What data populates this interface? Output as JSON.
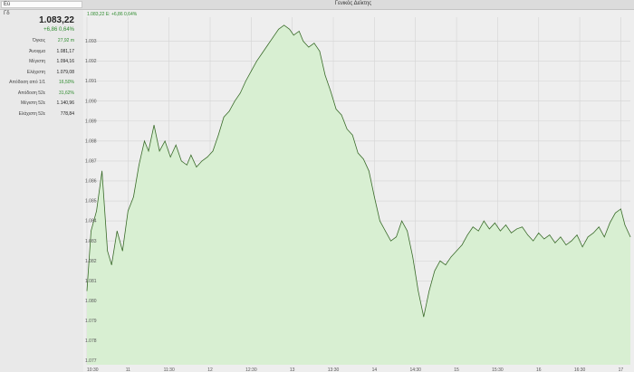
{
  "topbar": {
    "search_value": "Εύ",
    "title": "Γενικός Δείκτης"
  },
  "side": {
    "ticker": "Γδ",
    "last_price": "1.083,22",
    "change": "+6,86  0,64%",
    "stats": [
      {
        "label": "Όγκος",
        "value": "27,92 m",
        "positive": true
      },
      {
        "label": "Άνοιγμα",
        "value": "1.081,17",
        "positive": false
      },
      {
        "label": "Μέγιστη",
        "value": "1.094,16",
        "positive": false
      },
      {
        "label": "Ελάχιστη",
        "value": "1.079,08",
        "positive": false
      },
      {
        "label": "Απόδοση από 1/1",
        "value": "16,50%",
        "positive": true
      },
      {
        "label": "Απόδοση 52ε",
        "value": "31,62%",
        "positive": true
      },
      {
        "label": "Μέγιστη 52ε",
        "value": "1.140,96",
        "positive": false
      },
      {
        "label": "Ελάχιστη 52ε",
        "value": "778,84",
        "positive": false
      }
    ]
  },
  "colors": {
    "line": "#3a6b2a",
    "fill": "#d8efd2",
    "accent": "#2e8b2e"
  },
  "chart_data": {
    "type": "area",
    "header_label": "1.083,22 Ε: +6,86 0,64%",
    "ylim": [
      1076.8,
      1094.2
    ],
    "yticks": [
      1077,
      1078,
      1079,
      1080,
      1081,
      1082,
      1083,
      1084,
      1085,
      1086,
      1087,
      1088,
      1089,
      1090,
      1091,
      1092,
      1093
    ],
    "ytick_labels": [
      "1.077",
      "1.078",
      "1.079",
      "1.080",
      "1.081",
      "1.082",
      "1.083",
      "1.084",
      "1.085",
      "1.086",
      "1.087",
      "1.088",
      "1.089",
      "1.090",
      "1.091",
      "1.092",
      "1.093"
    ],
    "x_start": "10:30",
    "x_end": "17:07",
    "xticks": [
      "10:30",
      "11",
      "11:30",
      "12",
      "12:30",
      "13",
      "13:30",
      "14",
      "14:30",
      "15",
      "15:30",
      "16",
      "16:30",
      "17"
    ],
    "xtick_times": [
      "10:30",
      "11:00",
      "11:30",
      "12:00",
      "12:30",
      "13:00",
      "13:30",
      "14:00",
      "14:30",
      "15:00",
      "15:30",
      "16:00",
      "16:30",
      "17:00"
    ],
    "series": [
      {
        "times": [
          "10:30",
          "10:33",
          "10:37",
          "10:41",
          "10:45",
          "10:48",
          "10:52",
          "10:56",
          "11:00",
          "11:04",
          "11:08",
          "11:12",
          "11:15",
          "11:19",
          "11:23",
          "11:27",
          "11:31",
          "11:35",
          "11:39",
          "11:43",
          "11:46",
          "11:50",
          "11:54",
          "11:58",
          "12:02",
          "12:06",
          "12:10",
          "12:14",
          "12:18",
          "12:22",
          "12:26",
          "12:30",
          "12:34",
          "12:38",
          "12:42",
          "12:46",
          "12:50",
          "12:54",
          "12:58",
          "13:01",
          "13:05",
          "13:08",
          "13:12",
          "13:16",
          "13:20",
          "13:24",
          "13:28",
          "13:32",
          "13:36",
          "13:40",
          "13:44",
          "13:48",
          "13:52",
          "13:56",
          "14:00",
          "14:04",
          "14:08",
          "14:12",
          "14:16",
          "14:20",
          "14:24",
          "14:28",
          "14:32",
          "14:36",
          "14:40",
          "14:44",
          "14:48",
          "14:52",
          "14:56",
          "15:00",
          "15:04",
          "15:08",
          "15:12",
          "15:16",
          "15:20",
          "15:24",
          "15:28",
          "15:32",
          "15:36",
          "15:40",
          "15:44",
          "15:48",
          "15:52",
          "15:56",
          "16:00",
          "16:04",
          "16:08",
          "16:12",
          "16:16",
          "16:20",
          "16:24",
          "16:28",
          "16:32",
          "16:36",
          "16:40",
          "16:44",
          "16:48",
          "16:52",
          "16:56",
          "17:00",
          "17:03",
          "17:07"
        ],
        "values": [
          1080.5,
          1083.5,
          1084.5,
          1086.5,
          1082.5,
          1081.8,
          1083.5,
          1082.5,
          1084.5,
          1085.2,
          1086.8,
          1088.0,
          1087.5,
          1088.8,
          1087.5,
          1088.0,
          1087.2,
          1087.8,
          1087.0,
          1086.8,
          1087.3,
          1086.7,
          1087.0,
          1087.2,
          1087.5,
          1088.3,
          1089.2,
          1089.5,
          1090.0,
          1090.4,
          1091.0,
          1091.5,
          1092.0,
          1092.4,
          1092.8,
          1093.2,
          1093.6,
          1093.8,
          1093.6,
          1093.3,
          1093.5,
          1093.0,
          1092.7,
          1092.9,
          1092.5,
          1091.3,
          1090.5,
          1089.6,
          1089.3,
          1088.6,
          1088.3,
          1087.4,
          1087.1,
          1086.5,
          1085.2,
          1084.0,
          1083.5,
          1083.0,
          1083.2,
          1084.0,
          1083.5,
          1082.2,
          1080.5,
          1079.2,
          1080.5,
          1081.5,
          1082.0,
          1081.8,
          1082.2,
          1082.5,
          1082.8,
          1083.3,
          1083.7,
          1083.5,
          1084.0,
          1083.6,
          1083.9,
          1083.5,
          1083.8,
          1083.4,
          1083.6,
          1083.7,
          1083.3,
          1083.0,
          1083.4,
          1083.1,
          1083.3,
          1082.9,
          1083.2,
          1082.8,
          1083.0,
          1083.3,
          1082.7,
          1083.2,
          1083.4,
          1083.7,
          1083.2,
          1083.9,
          1084.4,
          1084.6,
          1083.8,
          1083.2
        ]
      }
    ]
  }
}
